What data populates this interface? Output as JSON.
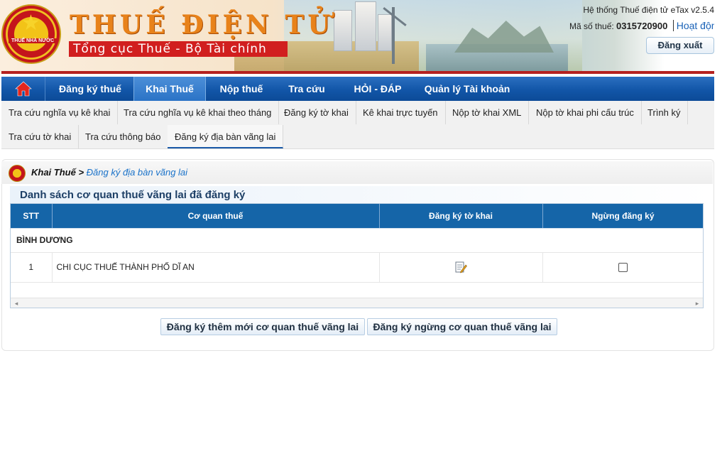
{
  "header": {
    "logo_title": "THUẾ ĐIỆN TỬ",
    "logo_subtitle": "Tổng cục Thuế - Bộ Tài chính",
    "emblem_text": "THUẾ NHÀ NƯỚC",
    "system_info": "Hệ thống Thuế điện tử eTax v2.5.4",
    "mst_label": "Mã số thuế:",
    "mst_value": "0315720900",
    "status": "Hoạt động",
    "logout_label": "Đăng xuất"
  },
  "main_nav": {
    "home_icon": "home-icon",
    "items": [
      {
        "label": "Đăng ký thuế"
      },
      {
        "label": "Khai Thuế"
      },
      {
        "label": "Nộp thuế"
      },
      {
        "label": "Tra cứu"
      },
      {
        "label": "HỎI - ĐÁP"
      },
      {
        "label": "Quản lý Tài khoản"
      }
    ],
    "active_index": 1
  },
  "sub_nav": {
    "items": [
      {
        "label": "Tra cứu nghĩa vụ kê khai"
      },
      {
        "label": "Tra cứu nghĩa vụ kê khai theo tháng"
      },
      {
        "label": "Đăng ký tờ khai"
      },
      {
        "label": "Kê khai trực tuyến"
      },
      {
        "label": "Nộp tờ khai XML"
      },
      {
        "label": "Nộp tờ khai phi cấu trúc"
      },
      {
        "label": "Trình ký"
      },
      {
        "label": "Tra cứu tờ khai"
      },
      {
        "label": "Tra cứu thông báo"
      },
      {
        "label": "Đăng ký địa bàn vãng lai"
      }
    ],
    "active_index": 9
  },
  "breadcrumb": {
    "root": "Khai Thuế",
    "separator": " > ",
    "current": "Đăng ký địa bàn vãng lai"
  },
  "section_title": "Danh sách cơ quan thuế vãng lai đã đăng ký",
  "table": {
    "headers": [
      "STT",
      "Cơ quan thuế",
      "Đăng ký tờ khai",
      "Ngừng đăng ký"
    ],
    "group_label": "BÌNH DƯƠNG",
    "rows": [
      {
        "stt": "1",
        "name": "CHI CỤC THUẾ THÀNH PHỐ DĨ AN",
        "register_icon": "edit-document-icon",
        "stop_checked": false
      }
    ]
  },
  "buttons": {
    "add_new": "Đăng ký thêm mới cơ quan thuế vãng lai",
    "stop": "Đăng ký ngừng cơ quan thuế vãng lai"
  },
  "colors": {
    "nav_blue": "#1256a8",
    "header_red": "#d11f1f",
    "title_orange": "#e8821a",
    "link_blue": "#1a72c9"
  }
}
